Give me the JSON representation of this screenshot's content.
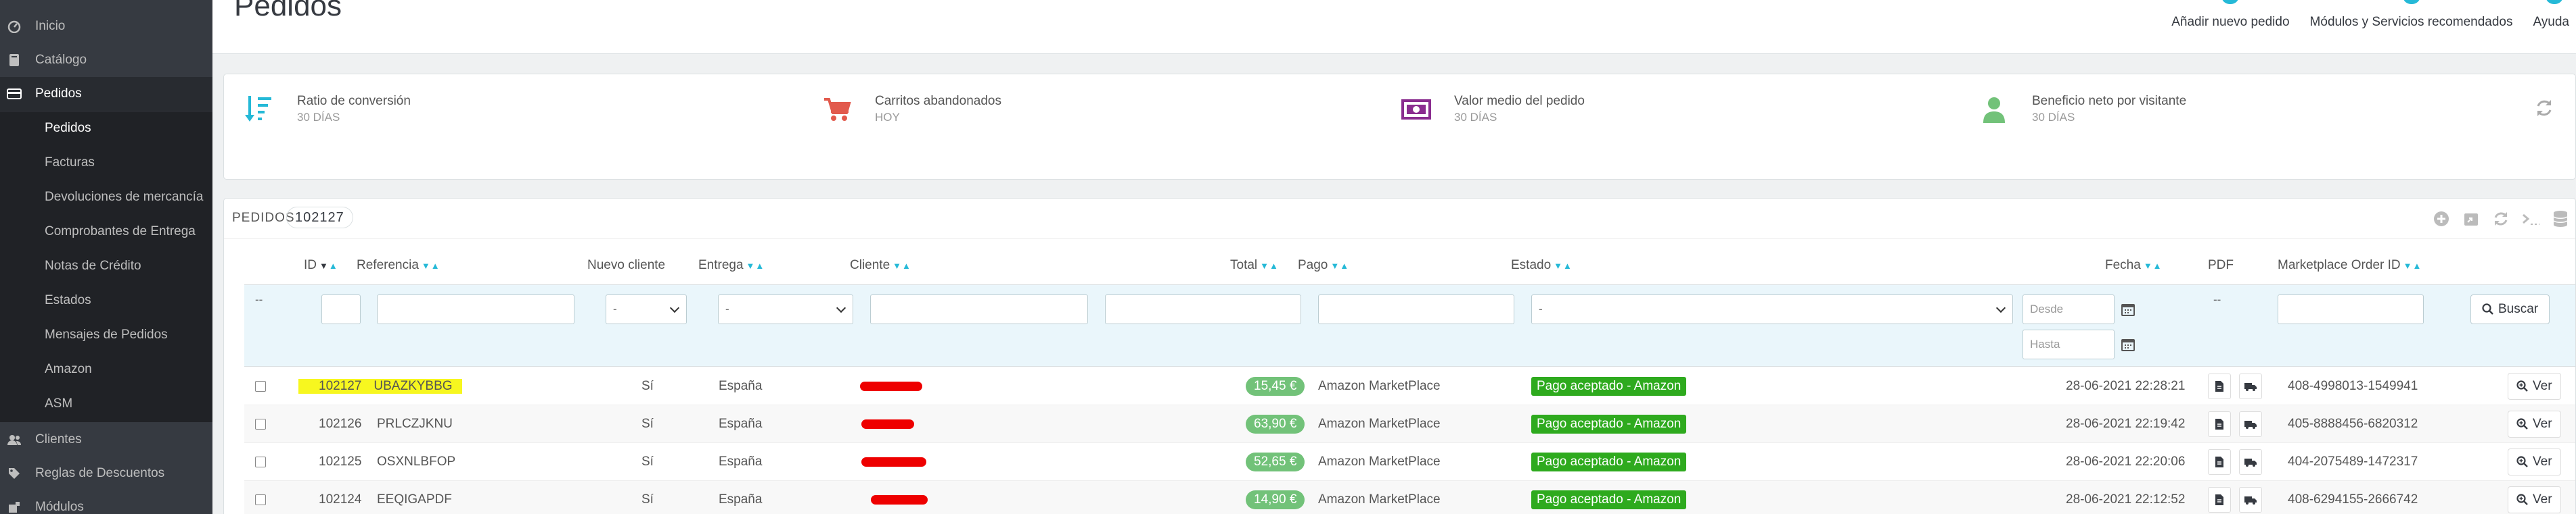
{
  "sidebar": {
    "items": [
      {
        "label": "Inicio",
        "icon": "dashboard-icon"
      },
      {
        "label": "Catálogo",
        "icon": "catalog-icon"
      },
      {
        "label": "Pedidos",
        "icon": "orders-icon"
      },
      {
        "label": "Clientes",
        "icon": "customers-icon"
      },
      {
        "label": "Reglas de Descuentos",
        "icon": "discount-icon"
      },
      {
        "label": "Módulos",
        "icon": "modules-icon"
      }
    ],
    "subitems": [
      "Pedidos",
      "Facturas",
      "Devoluciones de mercancía",
      "Comprobantes de Entrega",
      "Notas de Crédito",
      "Estados",
      "Mensajes de Pedidos",
      "Amazon",
      "ASM"
    ]
  },
  "header": {
    "title": "Pedidos",
    "toolbar": [
      "Añadir nuevo pedido",
      "Módulos y Servicios recomendados",
      "Ayuda"
    ]
  },
  "kpis": [
    {
      "label": "Ratio de conversión",
      "sub": "30 DÍAS",
      "icon": "conversion-icon",
      "color": "#25b9d7"
    },
    {
      "label": "Carritos abandonados",
      "sub": "HOY",
      "icon": "cart-icon",
      "color": "#e25a4d"
    },
    {
      "label": "Valor medio del pedido",
      "sub": "30 DÍAS",
      "icon": "money-icon",
      "color": "#8a2d8f"
    },
    {
      "label": "Beneficio neto por visitante",
      "sub": "30 DÍAS",
      "icon": "user-icon",
      "color": "#72c279"
    }
  ],
  "orders": {
    "title": "PEDIDOS",
    "count": "102127",
    "columns": {
      "id": "ID",
      "reference": "Referencia",
      "new_client": "Nuevo cliente",
      "delivery": "Entrega",
      "client": "Cliente",
      "total": "Total",
      "payment": "Pago",
      "status": "Estado",
      "date": "Fecha",
      "pdf": "PDF",
      "marketplace": "Marketplace Order ID"
    },
    "filters": {
      "dash": "--",
      "select_default": "-",
      "date_from": "Desde",
      "date_to": "Hasta",
      "search": "Buscar"
    },
    "rows": [
      {
        "id": "102127",
        "reference": "UBAZKYBBG",
        "new_client": "Sí",
        "delivery": "España",
        "total": "15,45 €",
        "payment": "Amazon MarketPlace",
        "status": "Pago aceptado - Amazon",
        "date": "28-06-2021 22:28:21",
        "marketplace": "408-4998013-1549941",
        "view": "Ver"
      },
      {
        "id": "102126",
        "reference": "PRLCZJKNU",
        "new_client": "Sí",
        "delivery": "España",
        "total": "63,90 €",
        "payment": "Amazon MarketPlace",
        "status": "Pago aceptado - Amazon",
        "date": "28-06-2021 22:19:42",
        "marketplace": "405-8888456-6820312",
        "view": "Ver"
      },
      {
        "id": "102125",
        "reference": "OSXNLBFOP",
        "new_client": "Sí",
        "delivery": "España",
        "total": "52,65 €",
        "payment": "Amazon MarketPlace",
        "status": "Pago aceptado - Amazon",
        "date": "28-06-2021 22:20:06",
        "marketplace": "404-2075489-1472317",
        "view": "Ver"
      },
      {
        "id": "102124",
        "reference": "EEQIGAPDF",
        "new_client": "Sí",
        "delivery": "España",
        "total": "14,90 €",
        "payment": "Amazon MarketPlace",
        "status": "Pago aceptado - Amazon",
        "date": "28-06-2021 22:12:52",
        "marketplace": "408-6294155-2666742",
        "view": "Ver"
      }
    ]
  }
}
